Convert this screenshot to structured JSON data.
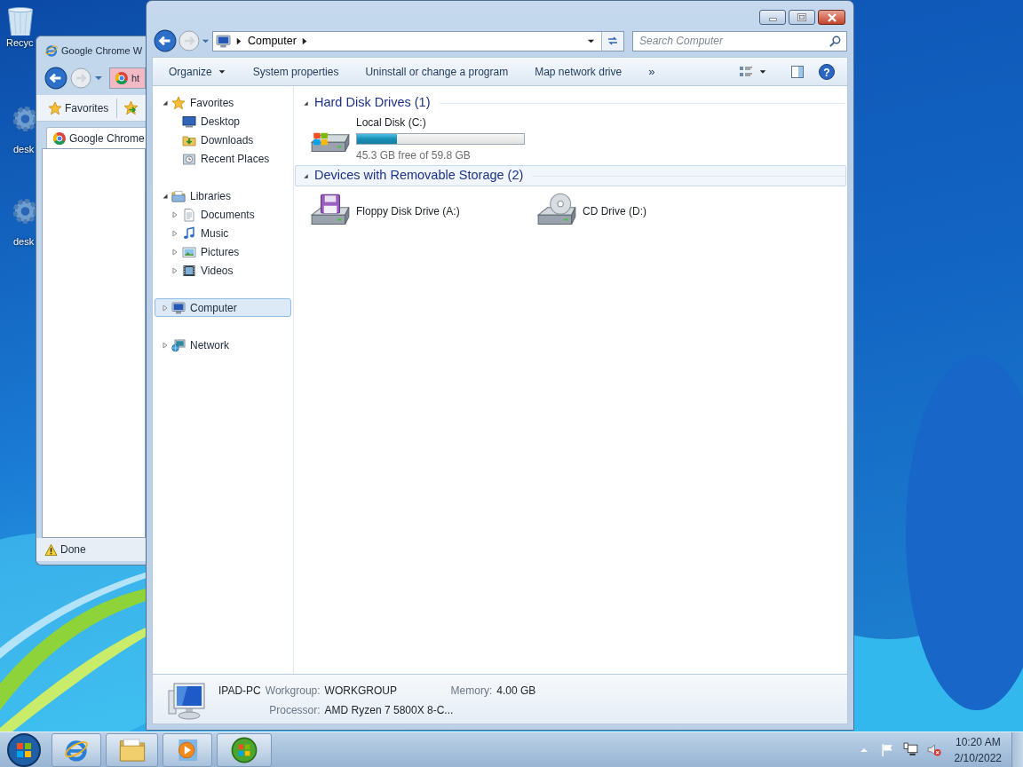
{
  "desktop_icons": [
    {
      "kind": "bin",
      "label": "Recyc"
    },
    {
      "kind": "gear",
      "label": "desk"
    },
    {
      "kind": "gear",
      "label": "desk"
    }
  ],
  "browser_window": {
    "title": "Google Chrome W",
    "address": "ht",
    "favorites": "Favorites",
    "tab": "Google Chrome",
    "status": "Done"
  },
  "explorer": {
    "breadcrumb": [
      "Computer"
    ],
    "search": {
      "placeholder": "Search Computer"
    },
    "toolbar": [
      "Organize",
      "System properties",
      "Uninstall or change a program",
      "Map network drive",
      "»"
    ],
    "help_button": "?",
    "nav": [
      {
        "label": "Favorites",
        "kind": "star",
        "expanded": true,
        "selected": false,
        "children": [
          {
            "label": "Desktop",
            "kind": "desktop",
            "selected": false
          },
          {
            "label": "Downloads",
            "kind": "downloads",
            "selected": false
          },
          {
            "label": "Recent Places",
            "kind": "recent",
            "selected": false
          }
        ]
      },
      {
        "label": "Libraries",
        "kind": "library",
        "expanded": true,
        "selected": false,
        "children": [
          {
            "label": "Documents",
            "kind": "documents",
            "expanded": false,
            "selected": false
          },
          {
            "label": "Music",
            "kind": "music",
            "expanded": false,
            "selected": false
          },
          {
            "label": "Pictures",
            "kind": "pictures",
            "expanded": false,
            "selected": false
          },
          {
            "label": "Videos",
            "kind": "videos",
            "expanded": false,
            "selected": false
          }
        ]
      },
      {
        "label": "Computer",
        "kind": "computer",
        "expanded": false,
        "selected": true
      },
      {
        "label": "Network",
        "kind": "network",
        "expanded": false,
        "selected": false
      }
    ],
    "groups": [
      {
        "title": "Hard Disk Drives (1)",
        "expanded": true,
        "hover": false,
        "items": [
          {
            "kind": "disk",
            "name": "Local Disk (C:)",
            "level": 0.24,
            "free": "45.3 GB free of 59.8 GB"
          }
        ]
      },
      {
        "title": "Devices with Removable Storage (2)",
        "expanded": true,
        "hover": true,
        "items": [
          {
            "kind": "floppy",
            "name": "Floppy Disk Drive (A:)"
          },
          {
            "kind": "cd",
            "name": "CD Drive (D:)"
          }
        ]
      }
    ],
    "details": {
      "name": "IPAD-PC",
      "rows": [
        [
          {
            "label": "Workgroup:",
            "value": "WORKGROUP"
          },
          {
            "label": "Memory:",
            "value": "4.00 GB"
          }
        ],
        [
          {
            "label": "Processor:",
            "value": "AMD Ryzen 7 5800X 8-C..."
          }
        ]
      ]
    }
  },
  "taskbar": {
    "apps": [
      {
        "kind": "browser"
      },
      {
        "kind": "folder"
      },
      {
        "kind": "media"
      },
      {
        "kind": "orb"
      }
    ],
    "clock": {
      "time": "10:20 AM",
      "date": "2/10/2022"
    }
  }
}
